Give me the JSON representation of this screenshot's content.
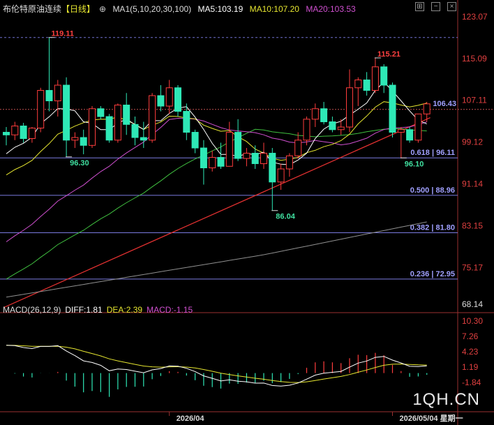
{
  "header": {
    "symbol": "布伦特原油连续",
    "period": "【日线】",
    "ma_title": "MA1(5,10,20,30,100)",
    "ma5": "MA5:103.19",
    "ma10": "MA10:107.20",
    "ma20": "MA20:103.53",
    "colors": {
      "ma5": "#ffffff",
      "ma10": "#e6e630",
      "ma20": "#d050d0",
      "ma30": "#40c040",
      "ma100": "#909090"
    }
  },
  "macd_header": {
    "title": "MACD(26,12,9)",
    "diff": "DIFF:1.81",
    "dea": "DEA:2.39",
    "macd": "MACD:-1.15"
  },
  "watermark": "1QH.CN",
  "chart_data": {
    "type": "candlestick",
    "price_axis": {
      "ticks": [
        123.07,
        115.09,
        107.11,
        99.12,
        91.14,
        83.15,
        75.17,
        68.14
      ],
      "ylim": [
        68.14,
        123.07
      ]
    },
    "current_price": 106.43,
    "annotations": [
      {
        "label": "119.11",
        "value": 119.11,
        "type": "high"
      },
      {
        "label": "115.21",
        "value": 115.21,
        "type": "high"
      },
      {
        "label": "96.30",
        "value": 96.3,
        "type": "low"
      },
      {
        "label": "86.04",
        "value": 86.04,
        "type": "low"
      },
      {
        "label": "96.10",
        "value": 96.1,
        "type": "low"
      }
    ],
    "fib_levels": [
      {
        "label": "0.618 | 96.11",
        "value": 96.11
      },
      {
        "label": "0.500 | 88.96",
        "value": 88.96
      },
      {
        "label": "0.382 | 81.80",
        "value": 81.8
      },
      {
        "label": "0.236 | 72.95",
        "value": 72.95
      }
    ],
    "trendline": {
      "from": [
        0,
        67.5
      ],
      "to": [
        46,
        101.3
      ]
    },
    "candles": [
      [
        101.0,
        102.0,
        98.5,
        100.5
      ],
      [
        100.5,
        103.0,
        99.5,
        102.2
      ],
      [
        102.2,
        102.8,
        99.0,
        99.8
      ],
      [
        99.8,
        102.0,
        99.0,
        101.8
      ],
      [
        101.8,
        109.5,
        101.0,
        109.0
      ],
      [
        109.0,
        119.11,
        105.0,
        107.0
      ],
      [
        107.0,
        111.0,
        104.0,
        110.0
      ],
      [
        110.0,
        111.5,
        96.3,
        99.5
      ],
      [
        99.5,
        101.0,
        98.0,
        100.0
      ],
      [
        100.0,
        101.5,
        96.8,
        98.5
      ],
      [
        98.5,
        106.0,
        98.0,
        105.5
      ],
      [
        105.5,
        106.0,
        103.5,
        104.0
      ],
      [
        104.0,
        104.5,
        99.0,
        99.5
      ],
      [
        99.5,
        106.5,
        99.0,
        106.2
      ],
      [
        106.2,
        108.5,
        100.5,
        102.5
      ],
      [
        102.5,
        104.0,
        98.5,
        100.0
      ],
      [
        100.0,
        103.0,
        98.0,
        99.5
      ],
      [
        99.5,
        108.5,
        99.0,
        108.0
      ],
      [
        108.0,
        110.0,
        105.0,
        106.0
      ],
      [
        106.0,
        111.0,
        104.5,
        109.5
      ],
      [
        109.5,
        110.0,
        104.0,
        105.0
      ],
      [
        105.0,
        106.5,
        99.5,
        101.0
      ],
      [
        101.0,
        101.5,
        97.0,
        98.0
      ],
      [
        98.0,
        99.5,
        91.0,
        94.2
      ],
      [
        94.2,
        97.5,
        93.5,
        96.2
      ],
      [
        96.2,
        99.0,
        94.0,
        94.5
      ],
      [
        94.5,
        103.0,
        95.0,
        101.0
      ],
      [
        101.0,
        103.5,
        95.5,
        96.0
      ],
      [
        96.0,
        98.0,
        94.5,
        97.0
      ],
      [
        97.0,
        98.5,
        94.0,
        95.0
      ],
      [
        95.0,
        99.0,
        94.0,
        97.0
      ],
      [
        97.0,
        98.0,
        86.04,
        91.5
      ],
      [
        91.5,
        95.0,
        90.0,
        94.0
      ],
      [
        94.0,
        97.0,
        92.5,
        96.5
      ],
      [
        96.5,
        101.0,
        96.0,
        99.5
      ],
      [
        99.5,
        104.0,
        98.5,
        103.5
      ],
      [
        103.5,
        106.5,
        102.0,
        105.5
      ],
      [
        105.5,
        106.8,
        102.5,
        103.0
      ],
      [
        103.0,
        104.0,
        101.0,
        101.5
      ],
      [
        101.5,
        103.5,
        100.5,
        102.0
      ],
      [
        102.0,
        113.0,
        101.0,
        109.5
      ],
      [
        109.5,
        111.5,
        106.0,
        111.0
      ],
      [
        111.0,
        112.5,
        108.0,
        109.0
      ],
      [
        109.0,
        115.21,
        108.5,
        113.5
      ],
      [
        113.5,
        114.0,
        108.5,
        110.0
      ],
      [
        110.0,
        110.5,
        100.0,
        101.0
      ],
      [
        101.0,
        102.0,
        96.1,
        101.5
      ],
      [
        101.5,
        102.0,
        99.0,
        99.5
      ],
      [
        99.5,
        104.5,
        99.0,
        104.5
      ],
      [
        104.5,
        106.8,
        103.0,
        106.43
      ]
    ],
    "macd_axis": {
      "ticks": [
        10.3,
        7.26,
        4.23,
        1.19,
        -1.84
      ],
      "ylim": [
        -4.2,
        11.0
      ]
    },
    "dates": [
      {
        "label": "2026/04",
        "index": 19
      },
      {
        "label": "2026/05/04 星期一",
        "index": 45
      }
    ]
  }
}
